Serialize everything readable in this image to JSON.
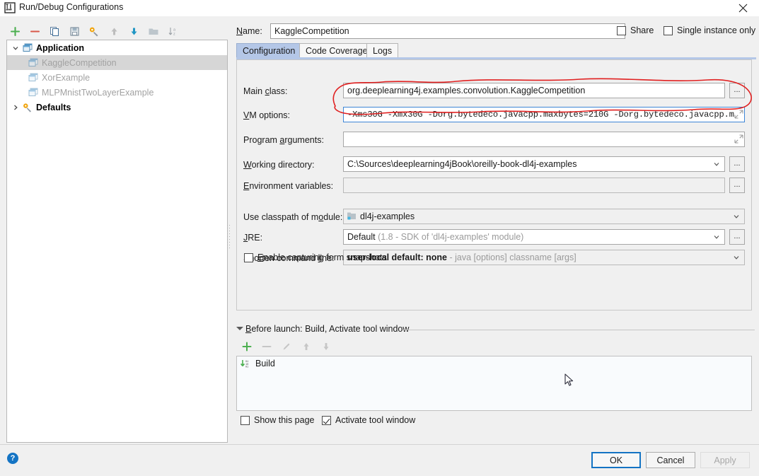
{
  "window": {
    "title": "Run/Debug Configurations",
    "app_icon": "intellij-idea-icon",
    "close_icon": "close-icon"
  },
  "toolbar": {
    "buttons": [
      {
        "name": "add-configuration-button",
        "icon": "plus-icon",
        "tooltip": "Add New Configuration"
      },
      {
        "name": "remove-configuration-button",
        "icon": "minus-icon",
        "tooltip": "Remove Configuration"
      },
      {
        "name": "copy-configuration-button",
        "icon": "copy-icon",
        "tooltip": "Copy Configuration"
      },
      {
        "name": "save-configuration-button",
        "icon": "save-icon",
        "tooltip": "Save Configuration"
      },
      {
        "name": "edit-defaults-button",
        "icon": "wrench-gear-icon",
        "tooltip": "Edit defaults"
      },
      {
        "name": "move-up-button",
        "icon": "arrow-up-icon",
        "tooltip": "Move Up"
      },
      {
        "name": "move-down-button",
        "icon": "arrow-down-icon",
        "tooltip": "Move Down"
      },
      {
        "name": "create-folder-button",
        "icon": "folder-icon",
        "tooltip": "Create New Folder"
      },
      {
        "name": "sort-configurations-button",
        "icon": "sort-alphabetical-icon",
        "tooltip": "Sort Configurations"
      }
    ]
  },
  "tree": {
    "nodes": [
      {
        "label": "Application",
        "type": "group",
        "expanded": true,
        "icon": "application-icon",
        "arrow": "chevron-down-icon"
      },
      {
        "label": "KaggleCompetition",
        "type": "child",
        "selected": true,
        "icon": "application-icon"
      },
      {
        "label": "XorExample",
        "type": "child",
        "selected": false,
        "icon": "application-icon"
      },
      {
        "label": "MLPMnistTwoLayerExample",
        "type": "child",
        "selected": false,
        "icon": "application-icon"
      },
      {
        "label": "Defaults",
        "type": "group",
        "expanded": false,
        "icon": "wrench-gear-icon",
        "arrow": "chevron-right-icon"
      }
    ]
  },
  "header": {
    "name_label": "Name:",
    "name_value": "KaggleCompetition",
    "share_label": "Share",
    "share_checked": false,
    "single_instance_label": "Single instance only",
    "single_instance_checked": false
  },
  "tabs": [
    {
      "label": "Configuration",
      "active": true
    },
    {
      "label": "Code Coverage",
      "active": false
    },
    {
      "label": "Logs",
      "active": false
    }
  ],
  "form": {
    "main_class": {
      "label": "Main class:",
      "value": "org.deeplearning4j.examples.convolution.KaggleCompetition",
      "browse_label": "..."
    },
    "vm_options": {
      "label": "VM options:",
      "value": "-Xms30G -Xmx30G -Dorg.bytedeco.javacpp.maxbytes=210G -Dorg.bytedeco.javacpp.m",
      "expand_icon": "expand-icon",
      "focused": true
    },
    "program_arguments": {
      "label": "Program arguments:",
      "value": "",
      "expand_icon": "expand-icon"
    },
    "working_directory": {
      "label": "Working directory:",
      "value": "C:\\Sources\\deeplearning4jBook\\oreilly-book-dl4j-examples",
      "dropdown_icon": "chevron-down-icon",
      "browse_label": "..."
    },
    "environment_variables": {
      "label": "Environment variables:",
      "value": "",
      "browse_label": "..."
    },
    "classpath_module": {
      "label": "Use classpath of module:",
      "value": "dl4j-examples",
      "icon": "module-icon",
      "dropdown_icon": "chevron-down-icon"
    },
    "jre": {
      "label": "JRE:",
      "value": "Default",
      "hint": "(1.8 - SDK of 'dl4j-examples' module)",
      "dropdown_icon": "chevron-down-icon",
      "browse_label": "..."
    },
    "shorten_command_line": {
      "label": "Shorten command line:",
      "value": "user-local default: none",
      "hint": "- java [options] classname [args]",
      "dropdown_icon": "chevron-down-icon"
    },
    "enable_snapshots": {
      "label": "Enable capturing form snapshots",
      "checked": false
    }
  },
  "before_launch": {
    "header": "Before launch: Build, Activate tool window",
    "toolbar": [
      {
        "name": "add-task-button",
        "icon": "plus-icon"
      },
      {
        "name": "remove-task-button",
        "icon": "minus-icon"
      },
      {
        "name": "edit-task-button",
        "icon": "pencil-icon"
      },
      {
        "name": "move-task-up-button",
        "icon": "arrow-up-icon"
      },
      {
        "name": "move-task-down-button",
        "icon": "arrow-down-icon"
      }
    ],
    "items": [
      {
        "label": "Build",
        "icon": "build-icon"
      }
    ],
    "show_this_page": {
      "label": "Show this page",
      "checked": false
    },
    "activate_tool_window": {
      "label": "Activate tool window",
      "checked": true
    }
  },
  "footer": {
    "help_icon": "help-icon",
    "ok_label": "OK",
    "cancel_label": "Cancel",
    "apply_label": "Apply",
    "apply_disabled": true
  },
  "annotation": {
    "color": "#e02020",
    "shape": "hand-drawn-ellipse-around-vm-options"
  },
  "colors": {
    "accent": "#1474c4",
    "tab_active": "#b4c7e7",
    "selection": "#d6d6d6",
    "annotation_red": "#e02020"
  }
}
